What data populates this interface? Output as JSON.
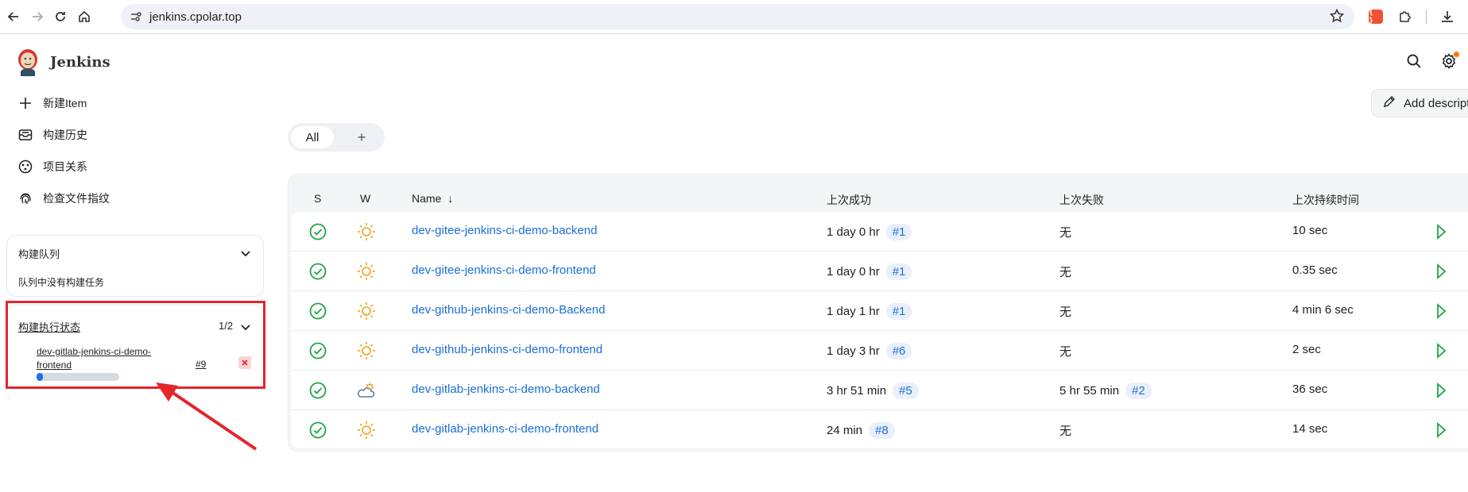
{
  "browser": {
    "url": "jenkins.cpolar.top",
    "ext_label": "{ }"
  },
  "header": {
    "brand": "Jenkins"
  },
  "sidebar": {
    "items": [
      {
        "label": "新建Item",
        "icon": "plus-icon"
      },
      {
        "label": "构建历史",
        "icon": "inbox-icon"
      },
      {
        "label": "项目关系",
        "icon": "relationship-icon"
      },
      {
        "label": "检查文件指纹",
        "icon": "fingerprint-icon"
      }
    ],
    "queue": {
      "title": "构建队列",
      "empty_text": "队列中没有构建任务"
    },
    "executors": {
      "title": "构建执行状态",
      "count": "1/2",
      "job_name": "dev-gitlab-jenkins-ci-demo-frontend",
      "build": "#9",
      "progress": 0.08,
      "highlight_color": "#e4252b"
    }
  },
  "main": {
    "add_description": "Add description",
    "tabs": {
      "all": "All",
      "add": "+"
    },
    "table": {
      "headers": {
        "s": "S",
        "w": "W",
        "name": "Name",
        "sort_arrow": "↓",
        "last_success": "上次成功",
        "last_failure": "上次失败",
        "last_duration": "上次持续时间"
      },
      "rows": [
        {
          "name": "dev-gitee-jenkins-ci-demo-backend",
          "success": "1 day 0 hr",
          "success_build": "#1",
          "failure": "无",
          "failure_build": "",
          "duration": "10 sec",
          "weather": "sunny"
        },
        {
          "name": "dev-gitee-jenkins-ci-demo-frontend",
          "success": "1 day 0 hr",
          "success_build": "#1",
          "failure": "无",
          "failure_build": "",
          "duration": "0.35 sec",
          "weather": "sunny"
        },
        {
          "name": "dev-github-jenkins-ci-demo-Backend",
          "success": "1 day 1 hr",
          "success_build": "#1",
          "failure": "无",
          "failure_build": "",
          "duration": "4 min 6 sec",
          "weather": "sunny"
        },
        {
          "name": "dev-github-jenkins-ci-demo-frontend",
          "success": "1 day 3 hr",
          "success_build": "#6",
          "failure": "无",
          "failure_build": "",
          "duration": "2 sec",
          "weather": "sunny"
        },
        {
          "name": "dev-gitlab-jenkins-ci-demo-backend",
          "success": "3 hr 51 min",
          "success_build": "#5",
          "failure": "5 hr 55 min",
          "failure_build": "#2",
          "duration": "36 sec",
          "weather": "partly-cloudy"
        },
        {
          "name": "dev-gitlab-jenkins-ci-demo-frontend",
          "success": "24 min",
          "success_build": "#8",
          "failure": "无",
          "failure_build": "",
          "duration": "14 sec",
          "weather": "sunny"
        }
      ]
    }
  },
  "colors": {
    "link": "#1a6ed8",
    "success": "#1ea446",
    "sun": "#f0a21b"
  }
}
